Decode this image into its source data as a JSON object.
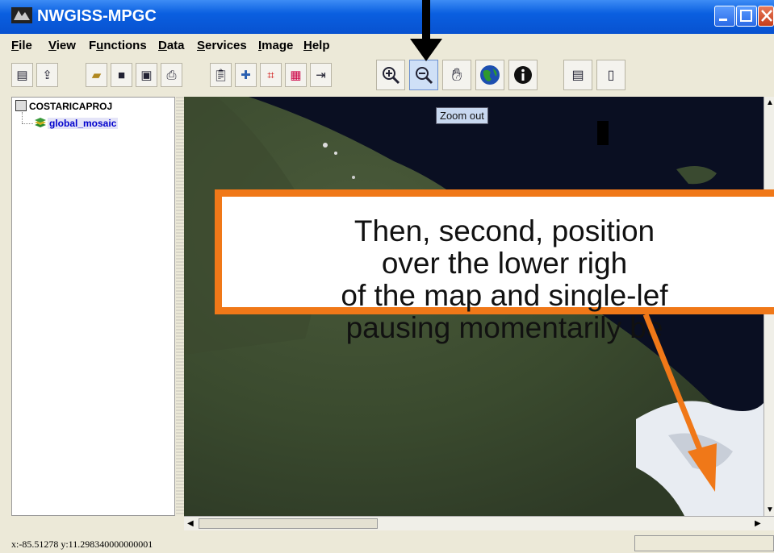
{
  "window": {
    "title": "NWGISS-MPGC"
  },
  "menu": [
    {
      "label": "File",
      "key": "F",
      "rest": "ile"
    },
    {
      "label": "View",
      "key": "V",
      "rest": "iew"
    },
    {
      "label": "Functions",
      "key": "u",
      "pre": "F",
      "rest": "nctions"
    },
    {
      "label": "Data",
      "key": "D",
      "rest": "ata"
    },
    {
      "label": "Services",
      "key": "S",
      "rest": "ervices"
    },
    {
      "label": "Image",
      "key": "I",
      "rest": "mage"
    },
    {
      "label": "Help",
      "key": "H",
      "rest": "elp"
    }
  ],
  "toolbar": {
    "buttons": [
      "new-project",
      "open-project",
      "open-folder",
      "save",
      "save-all",
      "print",
      "paste",
      "add-layer",
      "crop",
      "mosaic",
      "export",
      "zoom-in",
      "zoom-out",
      "pan",
      "globe",
      "info",
      "tile-horizontal",
      "document"
    ],
    "active": "zoom-out"
  },
  "tooltip": {
    "text": "Zoom out"
  },
  "tree": {
    "root": "COSTARICAPROJ",
    "child": "global_mosaic"
  },
  "status": {
    "coords": "x:-85.51278  y:11.298340000000001"
  },
  "callout": {
    "lines": [
      "Then, second, position",
      "over the lower righ",
      "of the map and single-lef",
      "pausing momentarily be"
    ]
  },
  "colors": {
    "accent": "#f07818",
    "titlebar": "#0a5fe0",
    "tree_link": "#0000cc"
  }
}
